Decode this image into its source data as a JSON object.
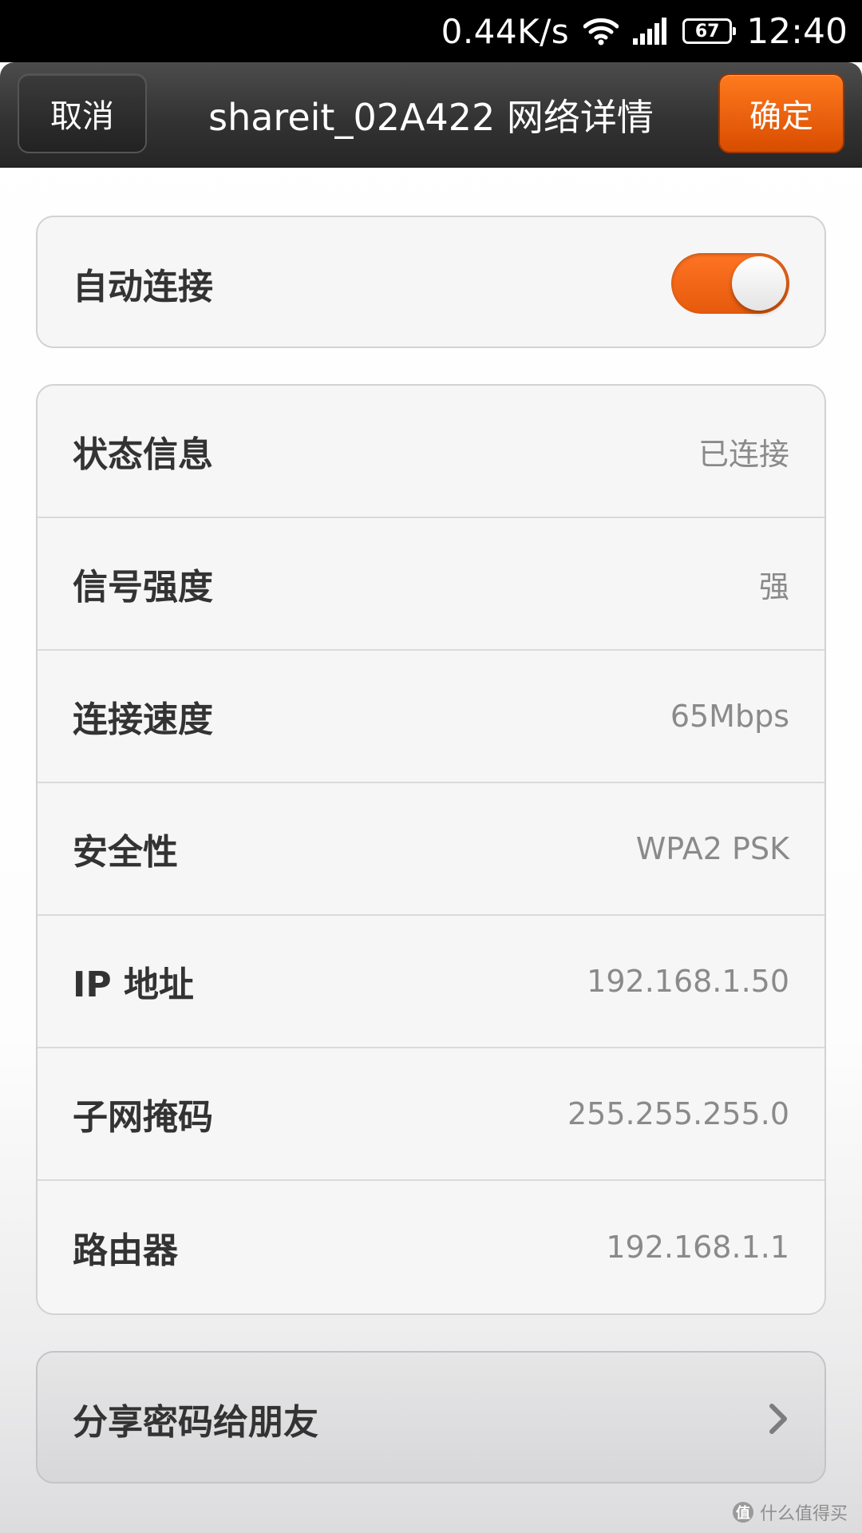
{
  "status_bar": {
    "net_speed": "0.44K/s",
    "battery": "67",
    "time": "12:40"
  },
  "title_bar": {
    "cancel_label": "取消",
    "title": "shareit_02A422 网络详情",
    "confirm_label": "确定"
  },
  "auto_connect": {
    "label": "自动连接",
    "enabled": true
  },
  "details": [
    {
      "label": "状态信息",
      "value": "已连接"
    },
    {
      "label": "信号强度",
      "value": "强"
    },
    {
      "label": "连接速度",
      "value": "65Mbps"
    },
    {
      "label": "安全性",
      "value": "WPA2 PSK"
    },
    {
      "label": "IP 地址",
      "value": "192.168.1.50"
    },
    {
      "label": "子网掩码",
      "value": "255.255.255.0"
    },
    {
      "label": "路由器",
      "value": "192.168.1.1"
    }
  ],
  "share": {
    "label": "分享密码给朋友"
  },
  "watermark": {
    "text": "什么值得买",
    "icon_glyph": "值"
  },
  "colors": {
    "accent": "#f26514",
    "title_bar": "#333333",
    "card_bg": "#f6f6f6"
  }
}
